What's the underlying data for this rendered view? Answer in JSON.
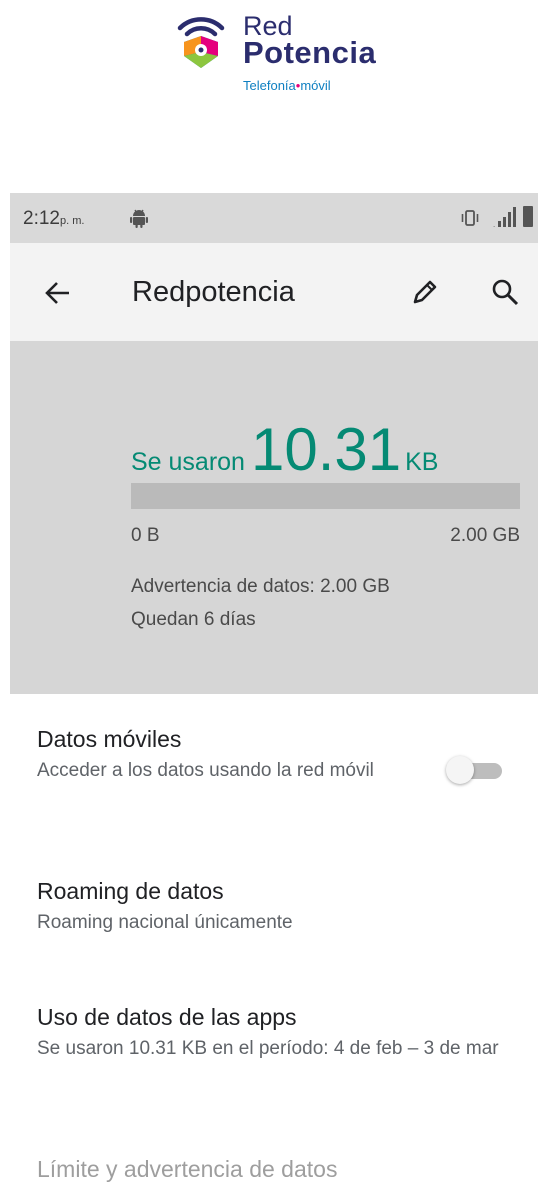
{
  "brand": {
    "name_line1": "Red",
    "name_line2": "Potencia",
    "tagline_part1": "Telefonía",
    "tagline_dot": "•",
    "tagline_part2": "móvil"
  },
  "status_bar": {
    "time": "2:12",
    "time_suffix": "p. m.",
    "icons": [
      "android-icon",
      "vibrate-icon",
      "signal-icon",
      "battery-icon"
    ]
  },
  "app_bar": {
    "title": "Redpotencia",
    "icons": [
      "back-arrow-icon",
      "edit-icon",
      "search-icon"
    ]
  },
  "usage": {
    "used_prefix": "Se usaron",
    "used_value": "10.31",
    "used_unit": "KB",
    "progress_fraction": 0.0,
    "range_min": "0 B",
    "range_max": "2.00 GB",
    "warning": "Advertencia de datos: 2.00 GB",
    "days_left": "Quedan 6 días"
  },
  "settings": {
    "mobile_data": {
      "title": "Datos móviles",
      "subtitle": "Acceder a los datos usando la red móvil",
      "enabled": false
    },
    "roaming": {
      "title": "Roaming de datos",
      "subtitle": "Roaming nacional únicamente"
    },
    "app_usage": {
      "title": "Uso de datos de las apps",
      "subtitle": "Se usaron 10.31 KB en el período: 4 de feb – 3 de mar"
    },
    "limit": {
      "title": "Límite y advertencia de datos"
    }
  },
  "colors": {
    "accent": "#058a74",
    "brand_navy": "#2b2d6e",
    "brand_blue": "#0e7fc1",
    "brand_magenta": "#e5007d",
    "usage_background": "#d6d6d6",
    "status_bar_background": "#d9d9d9"
  }
}
